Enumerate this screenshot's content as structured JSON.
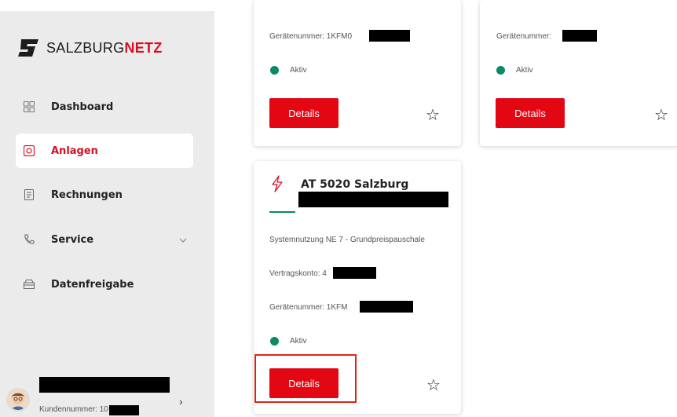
{
  "brand": {
    "part1": "SALZBURG",
    "part2": "NETZ",
    "accent": "#d60f22"
  },
  "nav": [
    {
      "label": "Dashboard",
      "icon": "grid-icon"
    },
    {
      "label": "Anlagen",
      "icon": "meter-icon",
      "active": true
    },
    {
      "label": "Rechnungen",
      "icon": "document-icon"
    },
    {
      "label": "Service",
      "icon": "phone-icon",
      "expandable": true
    },
    {
      "label": "Datenfreigabe",
      "icon": "share-tray-icon"
    }
  ],
  "user": {
    "kundennummer": "Kundennummer: 10",
    "arrow": "›"
  },
  "cards": [
    {
      "geraetenummer": "Gerätenummer: 1KFM0",
      "status": "Aktiv",
      "button": "Details",
      "star": "☆"
    },
    {
      "geraetenummer": "Gerätenummer:",
      "status": "Aktiv",
      "button": "Details",
      "star": "☆"
    },
    {
      "title": "AT 5020 Salzburg",
      "product": "Systemnutzung NE 7 - Grundpreispauschale",
      "vertragskonto": "Vertragskonto: 4",
      "geraetenummer": "Gerätenummer: 1KFM",
      "status": "Aktiv",
      "button": "Details",
      "star": "☆"
    }
  ]
}
